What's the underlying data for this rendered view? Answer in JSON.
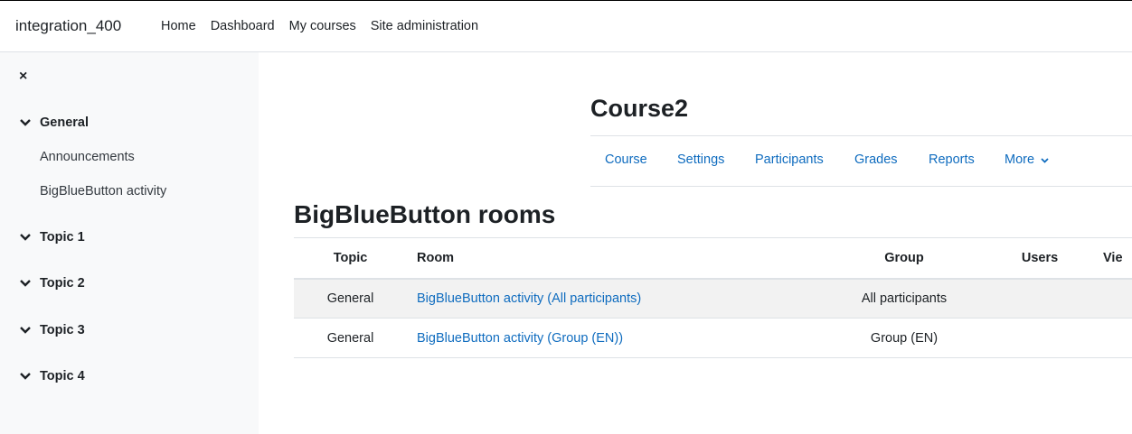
{
  "site_name": "integration_400",
  "nav": [
    "Home",
    "Dashboard",
    "My courses",
    "Site administration"
  ],
  "drawer": {
    "close_icon": "×",
    "sections": [
      {
        "label": "General",
        "activities": [
          "Announcements",
          "BigBlueButton activity"
        ]
      },
      {
        "label": "Topic 1",
        "activities": []
      },
      {
        "label": "Topic 2",
        "activities": []
      },
      {
        "label": "Topic 3",
        "activities": []
      },
      {
        "label": "Topic 4",
        "activities": []
      }
    ]
  },
  "course_title": "Course2",
  "secondary_nav": [
    "Course",
    "Settings",
    "Participants",
    "Grades",
    "Reports",
    "More"
  ],
  "page_heading": "BigBlueButton rooms",
  "table": {
    "headers": [
      "Topic",
      "Room",
      "Group",
      "Users",
      "Vie"
    ],
    "rows": [
      {
        "topic": "General",
        "room": "BigBlueButton activity (All participants)",
        "group": "All participants",
        "users": "",
        "view": ""
      },
      {
        "topic": "General",
        "room": "BigBlueButton activity (Group (EN))",
        "group": "Group (EN)",
        "users": "",
        "view": ""
      }
    ]
  }
}
